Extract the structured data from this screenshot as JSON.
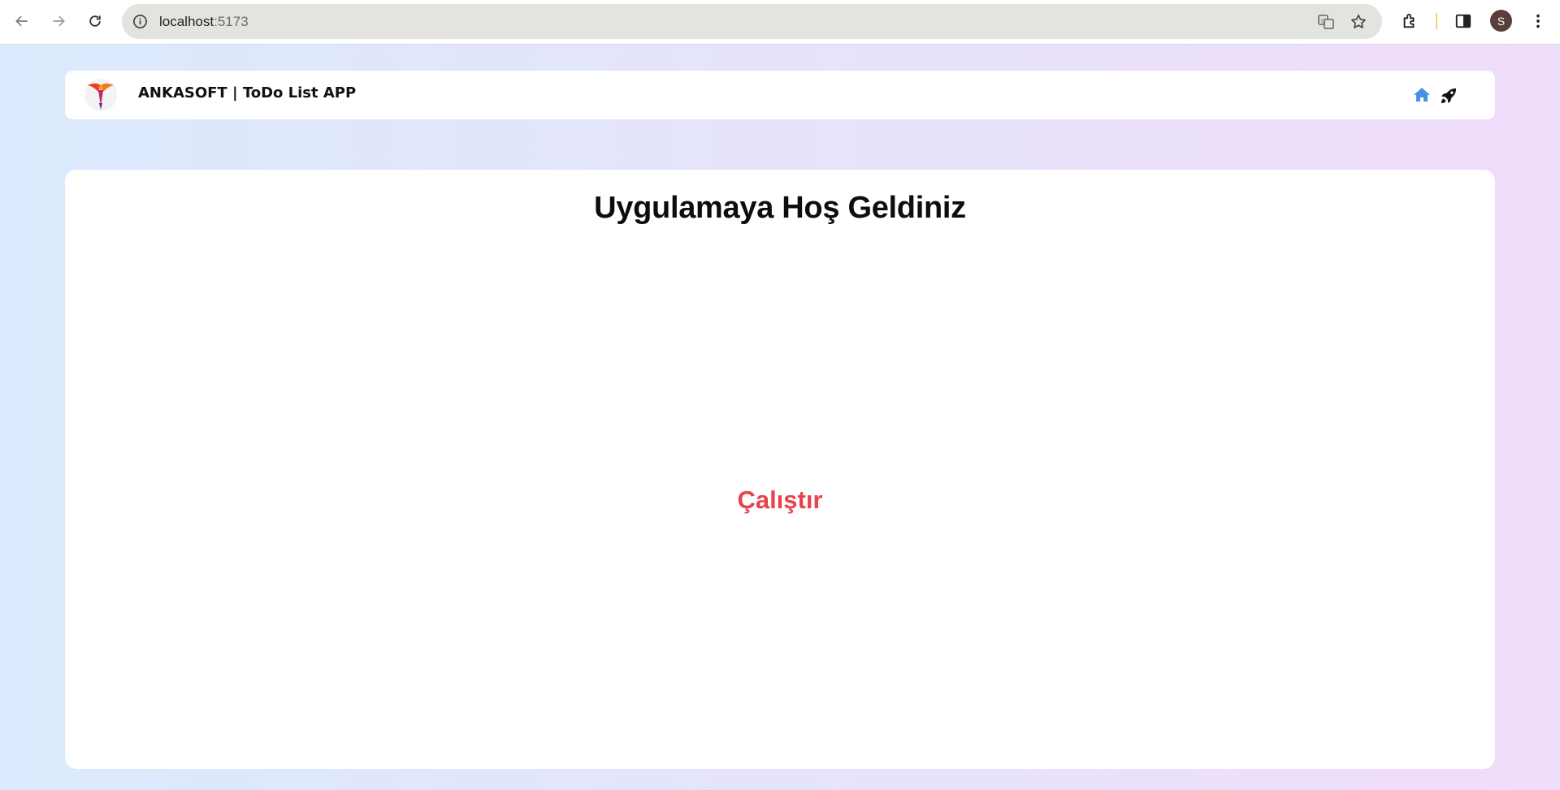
{
  "browser": {
    "url_host": "localhost",
    "url_port": ":5173",
    "profile_initial": "S"
  },
  "header": {
    "app_title": "ANKASOFT | ToDo List APP",
    "icons": [
      "home-icon",
      "rocket-icon"
    ],
    "home_icon_color": "#4a90e2"
  },
  "main": {
    "welcome_title": "Uygulamaya Hoş Geldiniz",
    "run_button_label": "Çalıştır",
    "run_button_color": "#e8434c"
  }
}
